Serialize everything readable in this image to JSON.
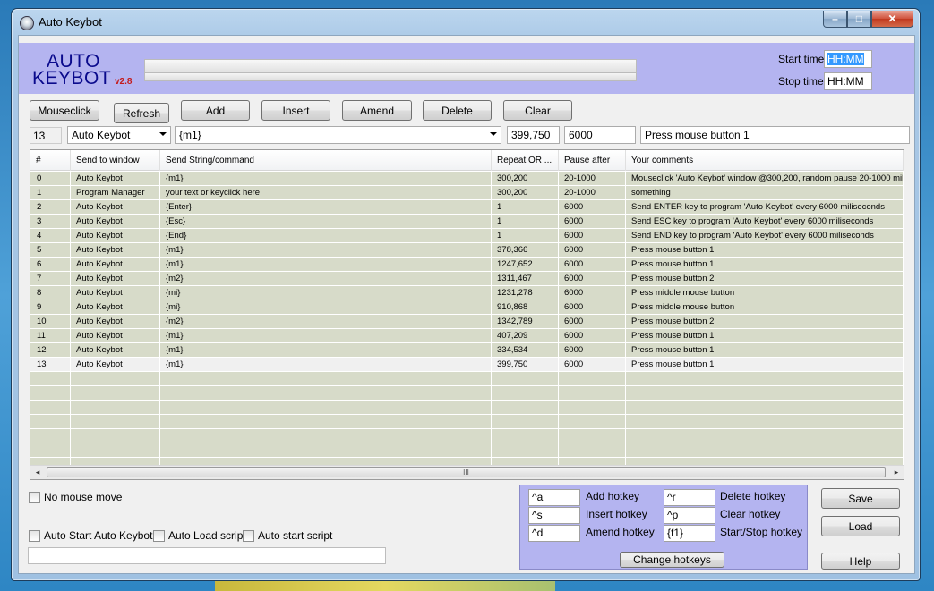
{
  "window": {
    "title": "Auto Keybot",
    "min_glyph": "–",
    "max_glyph": "□",
    "close_glyph": "✕"
  },
  "logo": {
    "auto": "AUTO",
    "keybot": "KEYBOT",
    "version": "v2.8"
  },
  "schedule": {
    "start_label": "Start time",
    "start_value": "HH:MM",
    "stop_label": "Stop time",
    "stop_value": "HH:MM"
  },
  "toolbar": {
    "mouseclick": "Mouseclick",
    "refresh": "Refresh",
    "add": "Add",
    "insert": "Insert",
    "amend": "Amend",
    "delete": "Delete",
    "clear": "Clear"
  },
  "editor": {
    "row_number": "13",
    "window": "Auto Keybot",
    "command": "{m1}",
    "repeat": "399,750",
    "pause": "6000",
    "comment": "Press mouse button 1"
  },
  "grid": {
    "columns": [
      "#",
      "Send to window",
      "Send String/command",
      "Repeat OR ...",
      "Pause after",
      "Your comments"
    ],
    "rows": [
      [
        "0",
        "Auto Keybot",
        "{m1}",
        "300,200",
        "20-1000",
        "Mouseclick 'Auto Keybot' window @300,200, random pause 20-1000 mil..."
      ],
      [
        "1",
        "Program Manager",
        "your text or keyclick here",
        "300,200",
        "20-1000",
        "something"
      ],
      [
        "2",
        "Auto Keybot",
        "{Enter}",
        "1",
        "6000",
        "Send ENTER key to program 'Auto Keybot' every 6000 miliseconds"
      ],
      [
        "3",
        "Auto Keybot",
        "{Esc}",
        "1",
        "6000",
        "Send ESC key to program 'Auto Keybot' every 6000 miliseconds"
      ],
      [
        "4",
        "Auto Keybot",
        "{End}",
        "1",
        "6000",
        "Send END key to program 'Auto Keybot' every 6000 miliseconds"
      ],
      [
        "5",
        "Auto Keybot",
        "{m1}",
        "378,366",
        "6000",
        "Press mouse button 1"
      ],
      [
        "6",
        "Auto Keybot",
        "{m1}",
        "1247,652",
        "6000",
        "Press mouse button 1"
      ],
      [
        "7",
        "Auto Keybot",
        "{m2}",
        "1311,467",
        "6000",
        "Press mouse button 2"
      ],
      [
        "8",
        "Auto Keybot",
        "{mi}",
        "1231,278",
        "6000",
        "Press middle mouse button"
      ],
      [
        "9",
        "Auto Keybot",
        "{mi}",
        "910,868",
        "6000",
        "Press middle mouse button"
      ],
      [
        "10",
        "Auto Keybot",
        "{m2}",
        "1342,789",
        "6000",
        "Press mouse button 2"
      ],
      [
        "11",
        "Auto Keybot",
        "{m1}",
        "407,209",
        "6000",
        "Press mouse button 1"
      ],
      [
        "12",
        "Auto Keybot",
        "{m1}",
        "334,534",
        "6000",
        "Press mouse button 1"
      ],
      [
        "13",
        "Auto Keybot",
        "{m1}",
        "399,750",
        "6000",
        "Press mouse button 1"
      ]
    ],
    "selected_row": 13,
    "empty_rows": 7,
    "scroll_grip": "III",
    "scroll_left_glyph": "◂",
    "scroll_right_glyph": "▸"
  },
  "options": {
    "no_mouse_move": "No mouse move",
    "auto_start_keybot": "Auto Start Auto Keybot",
    "auto_load_script": "Auto Load script",
    "auto_start_script": "Auto start script",
    "status_text": ""
  },
  "hotkeys": {
    "add_key": "^a",
    "add_label": "Add hotkey",
    "insert_key": "^s",
    "insert_label": "Insert hotkey",
    "amend_key": "^d",
    "amend_label": "Amend hotkey",
    "delete_key": "^r",
    "delete_label": "Delete hotkey",
    "clear_key": "^p",
    "clear_label": "Clear hotkey",
    "startstop_key": "{f1}",
    "startstop_label": "Start/Stop hotkey",
    "change_button": "Change hotkeys"
  },
  "actions": {
    "save": "Save",
    "load": "Load",
    "help": "Help"
  },
  "colors": {
    "header_band": "#b4b4f0",
    "row_bg": "#d7dbc9",
    "row_selected": "#f0f0f0",
    "logo_text": "#0a0a8c",
    "version_text": "#c41a1a"
  }
}
